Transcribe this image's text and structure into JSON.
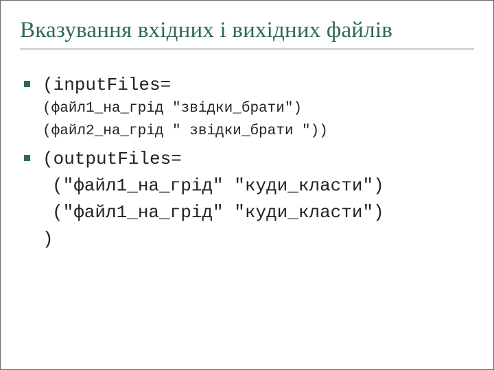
{
  "title": "Вказування вхідних і вихідних файлів",
  "items": [
    {
      "head": "(inputFiles=",
      "lines": [
        "(файл1_на_грід \"звідки_брати\")",
        "(файл2_на_грід \" звідки_брати \"))"
      ],
      "sub_size": "small"
    },
    {
      "head": "(outputFiles=",
      "lines": [
        "(\"файл1_на_грід\" \"куди_класти\")",
        "(\"файл1_на_грід\" \"куди_класти\")",
        ")"
      ],
      "sub_size": "large"
    }
  ]
}
